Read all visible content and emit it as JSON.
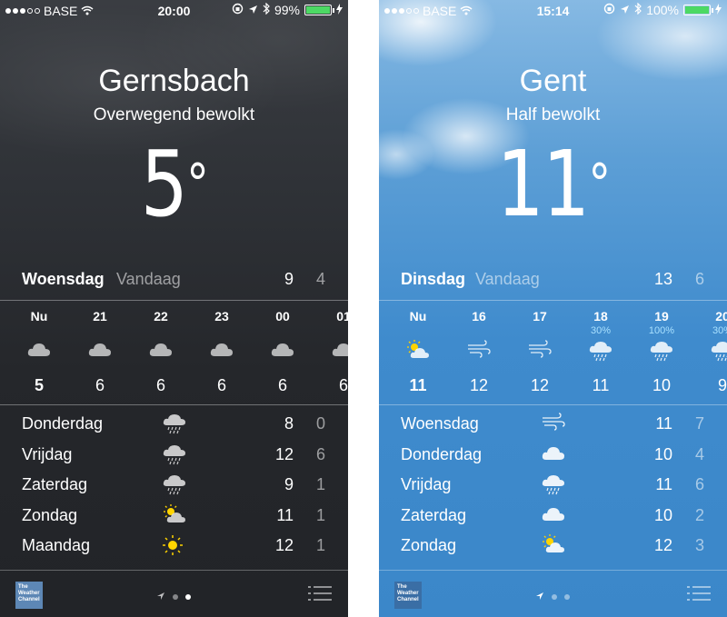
{
  "left": {
    "status": {
      "carrier": "BASE",
      "time": "20:00",
      "battery": "99%",
      "signal_filled": 3,
      "battery_level": 0.99
    },
    "city": "Gernsbach",
    "condition": "Overwegend bewolkt",
    "temperature": "5",
    "degree": "°",
    "today": {
      "day": "Woensdag",
      "label": "Vandaag",
      "high": "9",
      "low": "4"
    },
    "hourly": [
      {
        "hour": "Nu",
        "temp": "5",
        "icon": "cloud-icon",
        "pct": ""
      },
      {
        "hour": "21",
        "temp": "6",
        "icon": "cloud-icon",
        "pct": ""
      },
      {
        "hour": "22",
        "temp": "6",
        "icon": "cloud-icon",
        "pct": ""
      },
      {
        "hour": "23",
        "temp": "6",
        "icon": "cloud-icon",
        "pct": ""
      },
      {
        "hour": "00",
        "temp": "6",
        "icon": "cloud-icon",
        "pct": ""
      },
      {
        "hour": "01",
        "temp": "6",
        "icon": "cloud-icon",
        "pct": ""
      }
    ],
    "daily": [
      {
        "day": "Donderdag",
        "icon": "rain-cloud-icon",
        "high": "8",
        "low": "0"
      },
      {
        "day": "Vrijdag",
        "icon": "rain-cloud-icon",
        "high": "12",
        "low": "6"
      },
      {
        "day": "Zaterdag",
        "icon": "rain-cloud-icon",
        "high": "9",
        "low": "1"
      },
      {
        "day": "Zondag",
        "icon": "partly-sunny-icon",
        "high": "11",
        "low": "1"
      },
      {
        "day": "Maandag",
        "icon": "sun-icon",
        "high": "12",
        "low": "1"
      }
    ],
    "footer": {
      "logo": "The Weather Channel",
      "active_page": 2
    }
  },
  "right": {
    "status": {
      "carrier": "BASE",
      "time": "15:14",
      "battery": "100%",
      "signal_filled": 3,
      "battery_level": 1.0
    },
    "city": "Gent",
    "condition": "Half bewolkt",
    "temperature": "11",
    "degree": "°",
    "today": {
      "day": "Dinsdag",
      "label": "Vandaag",
      "high": "13",
      "low": "6"
    },
    "hourly": [
      {
        "hour": "Nu",
        "temp": "11",
        "icon": "partly-sunny-icon",
        "pct": ""
      },
      {
        "hour": "16",
        "temp": "12",
        "icon": "wind-icon",
        "pct": ""
      },
      {
        "hour": "17",
        "temp": "12",
        "icon": "wind-icon",
        "pct": ""
      },
      {
        "hour": "18",
        "temp": "11",
        "icon": "rain-cloud-icon",
        "pct": "30%"
      },
      {
        "hour": "19",
        "temp": "10",
        "icon": "rain-cloud-icon",
        "pct": "100%"
      },
      {
        "hour": "20",
        "temp": "9",
        "icon": "rain-cloud-icon",
        "pct": "30%"
      }
    ],
    "daily": [
      {
        "day": "Woensdag",
        "icon": "wind-icon",
        "high": "11",
        "low": "7"
      },
      {
        "day": "Donderdag",
        "icon": "cloud-icon",
        "high": "10",
        "low": "4"
      },
      {
        "day": "Vrijdag",
        "icon": "rain-cloud-icon",
        "high": "11",
        "low": "6"
      },
      {
        "day": "Zaterdag",
        "icon": "cloud-icon",
        "high": "10",
        "low": "2"
      },
      {
        "day": "Zondag",
        "icon": "partly-sunny-icon",
        "high": "12",
        "low": "3"
      }
    ],
    "footer": {
      "logo": "The Weather Channel",
      "active_page": 1
    }
  }
}
